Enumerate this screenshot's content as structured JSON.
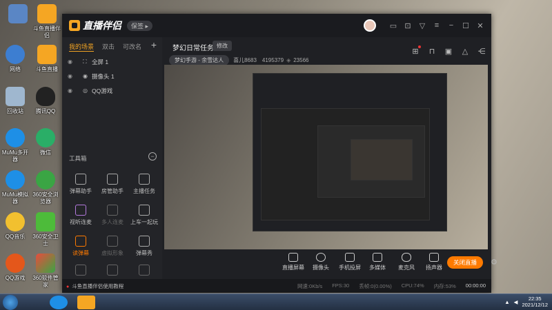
{
  "desktop": {
    "icons": [
      {
        "label": "",
        "color": "#5a86c5"
      },
      {
        "label": "斗鱼直播伴侣",
        "color": "#f5a623"
      },
      {
        "label": "网络",
        "color": "#3d7ed1"
      },
      {
        "label": "斗鱼直播",
        "color": "#f5a623"
      },
      {
        "label": "回收站",
        "color": "#9fb7cf"
      },
      {
        "label": "腾讯QQ",
        "color": "#222"
      },
      {
        "label": "MuMu多开器",
        "color": "#1e8fe6"
      },
      {
        "label": "微信",
        "color": "#2aae67"
      },
      {
        "label": "MuMu模拟器",
        "color": "#1e8fe6"
      },
      {
        "label": "360安全浏览器",
        "color": "#3aa544"
      },
      {
        "label": "QQ音乐",
        "color": "#f2c02f"
      },
      {
        "label": "360安全卫士",
        "color": "#4dbb3a"
      },
      {
        "label": "QQ游戏",
        "color": "#e4571b"
      },
      {
        "label": "360软件管家",
        "color": "#e94c3d"
      }
    ]
  },
  "app": {
    "name": "直播伴侣",
    "version_badge": "保签 ▸",
    "task_title": "梦幻日常任务！",
    "edit_label": "修改",
    "room_category": "梦幻手游 - 余雪达人",
    "room_id": "喜儿8683",
    "room_num": "4195379",
    "fans": "23566",
    "scene_tabs": [
      "我的场景",
      "双击",
      "可改名"
    ],
    "scene_add": "+",
    "sources": [
      {
        "label": "全屏 1",
        "icon": "⛶"
      },
      {
        "label": "摄像头 1",
        "icon": "◉"
      },
      {
        "label": "QQ游戏",
        "icon": "◎"
      }
    ],
    "tools_title": "工具箱",
    "tools_collapse": "−",
    "tools": [
      {
        "label": "弹幕助手",
        "dim": false
      },
      {
        "label": "房管助手",
        "dim": false
      },
      {
        "label": "主播任务",
        "dim": false
      },
      {
        "label": "视听连麦",
        "dim": false
      },
      {
        "label": "多人连麦",
        "dim": true
      },
      {
        "label": "上车一起玩",
        "dim": false
      },
      {
        "label": "读弹幕",
        "dim": false
      },
      {
        "label": "虚拟形象",
        "dim": true
      },
      {
        "label": "弹幕秀",
        "dim": false
      },
      {
        "label": "",
        "dim": true
      },
      {
        "label": "",
        "dim": true
      },
      {
        "label": "",
        "dim": true
      }
    ],
    "bottom_tools": [
      "直播屏幕",
      "摄像头",
      "手机投屏",
      "多媒体",
      "麦克风",
      "扬声器"
    ],
    "stop_label": "关闭直播",
    "status_tip": "斗鱼直播伴侣使用教程",
    "status": {
      "net": "网速:0Kb/s",
      "fps": "FPS:30",
      "drop": "丢帧:0(0.00%)",
      "cpu": "CPU:74%",
      "mem": "内存:53%",
      "timer": "00:00:00"
    }
  },
  "taskbar": {
    "time": "22:35",
    "date": "2021/12/12"
  },
  "colors": {
    "accent": "#f5a623",
    "stop": "#ff7a00",
    "window_bg": "#1f2024"
  }
}
